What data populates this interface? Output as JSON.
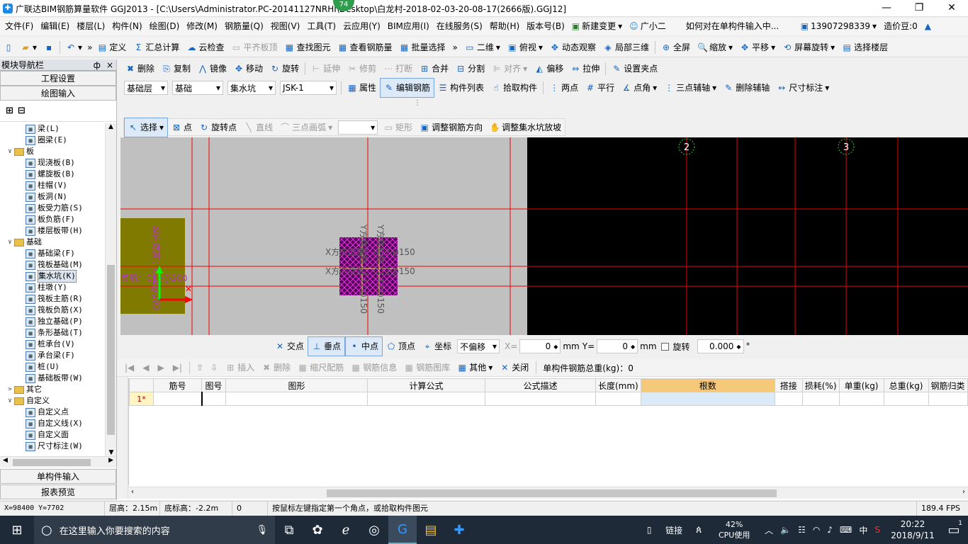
{
  "window": {
    "title": "广联达BIM钢筋算量软件 GGJ2013 - [C:\\Users\\Administrator.PC-20141127NRHI\\Desktop\\白龙村-2018-02-03-20-08-17(2666版).GGJ12]",
    "badge": "74",
    "minimize": "—",
    "restore": "❐",
    "close": "✕"
  },
  "menu": {
    "items": [
      "文件(F)",
      "编辑(E)",
      "楼层(L)",
      "构件(N)",
      "绘图(D)",
      "修改(M)",
      "钢筋量(Q)",
      "视图(V)",
      "工具(T)",
      "云应用(Y)",
      "BIM应用(I)",
      "在线服务(S)",
      "帮助(H)",
      "版本号(B)"
    ],
    "new_change": "新建变更",
    "assistant": "广小二",
    "help_question": "如何对在单构件输入中...",
    "phone": "13907298339",
    "price_bean": "造价豆:0"
  },
  "toolbar1": {
    "items": [
      "定义",
      "汇总计算",
      "云检查",
      "平齐板顶",
      "查找图元",
      "查看钢筋量",
      "批量选择",
      "二维",
      "俯视",
      "动态观察",
      "局部三维",
      "全屏",
      "缩放",
      "平移",
      "屏幕旋转",
      "选择楼层"
    ]
  },
  "toolbar2": {
    "items": [
      "删除",
      "复制",
      "镜像",
      "移动",
      "旋转",
      "延伸",
      "修剪",
      "打断",
      "合并",
      "分割",
      "对齐",
      "偏移",
      "拉伸",
      "设置夹点"
    ]
  },
  "toolbar3": {
    "floor": "基础层",
    "category": "基础",
    "type": "集水坑",
    "element": "JSK-1",
    "items": [
      "属性",
      "编辑钢筋",
      "构件列表",
      "拾取构件",
      "两点",
      "平行",
      "点角",
      "三点辅轴",
      "删除辅轴",
      "尺寸标注"
    ]
  },
  "toolbar4": {
    "items": [
      "选择",
      "点",
      "旋转点",
      "直线",
      "三点画弧",
      "矩形",
      "调整钢筋方向",
      "调整集水坑放坡"
    ]
  },
  "navigator": {
    "title": "模块导航栏",
    "pin": "ф",
    "close": "×",
    "project_settings": "工程设置",
    "drawing_input": "绘图输入",
    "single_input": "单构件输入",
    "report_preview": "报表预览",
    "tree": [
      {
        "label": "梁(L)",
        "level": 2,
        "icon": "beam-icon"
      },
      {
        "label": "圈梁(E)",
        "level": 2,
        "icon": "ring-beam-icon"
      },
      {
        "label": "板",
        "level": 1,
        "icon": "folder-icon",
        "expanded": true
      },
      {
        "label": "现浇板(B)",
        "level": 2,
        "icon": "slab-icon"
      },
      {
        "label": "螺旋板(B)",
        "level": 2,
        "icon": "spiral-slab-icon"
      },
      {
        "label": "柱帽(V)",
        "level": 2,
        "icon": "column-cap-icon"
      },
      {
        "label": "板洞(N)",
        "level": 2,
        "icon": "slab-hole-icon"
      },
      {
        "label": "板受力筋(S)",
        "level": 2,
        "icon": "slab-rebar-icon"
      },
      {
        "label": "板负筋(F)",
        "level": 2,
        "icon": "slab-neg-rebar-icon"
      },
      {
        "label": "楼层板带(H)",
        "level": 2,
        "icon": "floor-strip-icon"
      },
      {
        "label": "基础",
        "level": 1,
        "icon": "folder-icon",
        "expanded": true
      },
      {
        "label": "基础梁(F)",
        "level": 2,
        "icon": "foundation-beam-icon"
      },
      {
        "label": "筏板基础(M)",
        "level": 2,
        "icon": "raft-icon"
      },
      {
        "label": "集水坑(K)",
        "level": 2,
        "icon": "sump-icon",
        "selected": true
      },
      {
        "label": "柱墩(Y)",
        "level": 2,
        "icon": "pier-icon"
      },
      {
        "label": "筏板主筋(R)",
        "level": 2,
        "icon": "raft-main-rebar-icon"
      },
      {
        "label": "筏板负筋(X)",
        "level": 2,
        "icon": "raft-neg-rebar-icon"
      },
      {
        "label": "独立基础(P)",
        "level": 2,
        "icon": "isolated-footing-icon"
      },
      {
        "label": "条形基础(T)",
        "level": 2,
        "icon": "strip-footing-icon"
      },
      {
        "label": "桩承台(V)",
        "level": 2,
        "icon": "pile-cap-icon"
      },
      {
        "label": "承台梁(F)",
        "level": 2,
        "icon": "cap-beam-icon"
      },
      {
        "label": "桩(U)",
        "level": 2,
        "icon": "pile-icon"
      },
      {
        "label": "基础板带(W)",
        "level": 2,
        "icon": "foundation-strip-icon"
      },
      {
        "label": "其它",
        "level": 1,
        "icon": "folder-icon",
        "expanded": false
      },
      {
        "label": "自定义",
        "level": 1,
        "icon": "folder-icon",
        "expanded": true
      },
      {
        "label": "自定义点",
        "level": 2,
        "icon": "custom-point-icon"
      },
      {
        "label": "自定义线(X)",
        "level": 2,
        "icon": "custom-line-icon"
      },
      {
        "label": "自定义面",
        "level": 2,
        "icon": "custom-face-icon"
      },
      {
        "label": "尺寸标注(W)",
        "level": 2,
        "icon": "dimension-icon"
      }
    ]
  },
  "canvas": {
    "axis_labels": [
      "2",
      "3"
    ],
    "texts": {
      "x_top_rebar": "X方向面筋：C12@150",
      "x_bottom_rebar": "X方向底筋：C12@150",
      "y_top_rebar": "Y方向面筋：C12@150",
      "y_bottom_rebar": "Y方向底筋：C12@150",
      "left_rebar": "底筋：C12@200",
      "left_vertical": "纵向底筋：C12@200"
    }
  },
  "snapbar": {
    "items": [
      "交点",
      "垂点",
      "中点",
      "顶点",
      "坐标"
    ],
    "offset_mode": "不偏移",
    "x_label": "X=",
    "x_value": "0",
    "y_label": "Y=",
    "y_value": "0",
    "unit": "mm",
    "rotate_label": "旋转",
    "rotate_value": "0.000",
    "degree": "°"
  },
  "grid": {
    "toolbar": [
      "插入",
      "删除",
      "缩尺配筋",
      "钢筋信息",
      "钢筋图库",
      "其他",
      "关闭"
    ],
    "total_label": "单构件钢筋总重(kg)：0",
    "columns": [
      "筋号",
      "图号",
      "图形",
      "计算公式",
      "公式描述",
      "长度(mm)",
      "根数",
      "搭接",
      "损耗(%)",
      "单重(kg)",
      "总重(kg)",
      "钢筋归类"
    ],
    "row_num": "1*"
  },
  "status": {
    "coords": "X=98400 Y=7702",
    "floor_height": "层高：2.15m",
    "bottom_elev": "底标高：-2.2m",
    "value": "0",
    "hint": "按鼠标左键指定第一个角点，或拾取构件图元",
    "fps": "189.4 FPS"
  },
  "taskbar": {
    "search_placeholder": "在这里输入你要搜索的内容",
    "link": "链接",
    "cpu_percent": "42%",
    "cpu_label": "CPU使用",
    "ime": "中",
    "time": "20:22",
    "date": "2018/9/11",
    "notif": "1"
  }
}
